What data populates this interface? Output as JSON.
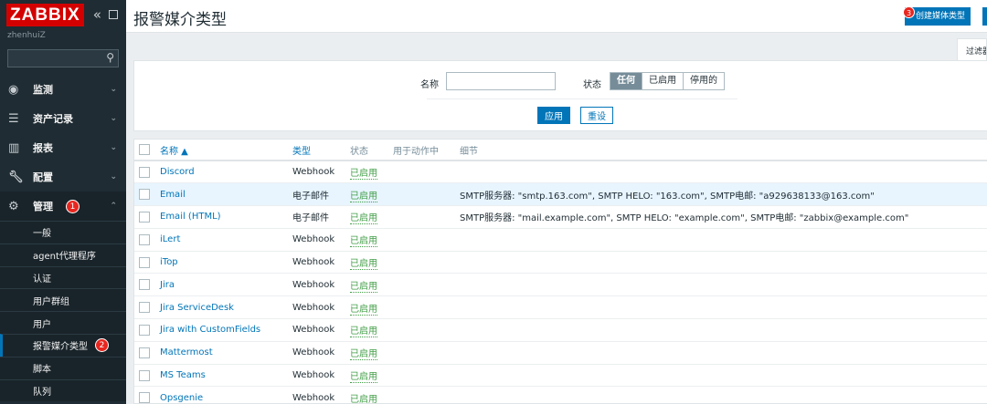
{
  "sidebar": {
    "logo": "ZABBIX",
    "username": "zhenhuiZ",
    "search_placeholder": "",
    "menu": [
      {
        "label": "监测",
        "icon": "eye-icon"
      },
      {
        "label": "资产记录",
        "icon": "list-icon"
      },
      {
        "label": "报表",
        "icon": "bar-chart-icon"
      },
      {
        "label": "配置",
        "icon": "wrench-icon"
      },
      {
        "label": "管理",
        "icon": "gear-icon",
        "badge": "1"
      }
    ],
    "submenu": [
      {
        "label": "一般"
      },
      {
        "label": "agent代理程序"
      },
      {
        "label": "认证"
      },
      {
        "label": "用户群组"
      },
      {
        "label": "用户"
      },
      {
        "label": "报警媒介类型",
        "badge": "2"
      },
      {
        "label": "脚本"
      },
      {
        "label": "队列"
      }
    ]
  },
  "header": {
    "title": "报警媒介类型",
    "create_button": "创建媒体类型",
    "create_badge": "3"
  },
  "filter": {
    "tab_label": "过滤器",
    "name_label": "名称",
    "name_value": "",
    "status_label": "状态",
    "status_options": [
      "任何",
      "已启用",
      "停用的"
    ],
    "status_selected": "任何",
    "apply": "应用",
    "reset": "重设"
  },
  "table": {
    "headers": {
      "name": "名称 ▲",
      "type": "类型",
      "status": "状态",
      "used_in_actions": "用于动作中",
      "details": "细节"
    },
    "rows": [
      {
        "name": "Discord",
        "type": "Webhook",
        "status": "已启用",
        "details": ""
      },
      {
        "name": "Email",
        "type": "电子邮件",
        "status": "已启用",
        "details": "SMTP服务器: \"smtp.163.com\", SMTP HELO: \"163.com\", SMTP电邮: \"a929638133@163.com\""
      },
      {
        "name": "Email (HTML)",
        "type": "电子邮件",
        "status": "已启用",
        "details": "SMTP服务器: \"mail.example.com\", SMTP HELO: \"example.com\", SMTP电邮: \"zabbix@example.com\""
      },
      {
        "name": "iLert",
        "type": "Webhook",
        "status": "已启用",
        "details": ""
      },
      {
        "name": "iTop",
        "type": "Webhook",
        "status": "已启用",
        "details": ""
      },
      {
        "name": "Jira",
        "type": "Webhook",
        "status": "已启用",
        "details": ""
      },
      {
        "name": "Jira ServiceDesk",
        "type": "Webhook",
        "status": "已启用",
        "details": ""
      },
      {
        "name": "Jira with CustomFields",
        "type": "Webhook",
        "status": "已启用",
        "details": ""
      },
      {
        "name": "Mattermost",
        "type": "Webhook",
        "status": "已启用",
        "details": ""
      },
      {
        "name": "MS Teams",
        "type": "Webhook",
        "status": "已启用",
        "details": ""
      },
      {
        "name": "Opsgenie",
        "type": "Webhook",
        "status": "已启用",
        "details": ""
      }
    ]
  },
  "colors": {
    "brand": "#d40000",
    "accent": "#0275b8",
    "enabled": "#429e47",
    "sidebar": "#1f2c33"
  }
}
